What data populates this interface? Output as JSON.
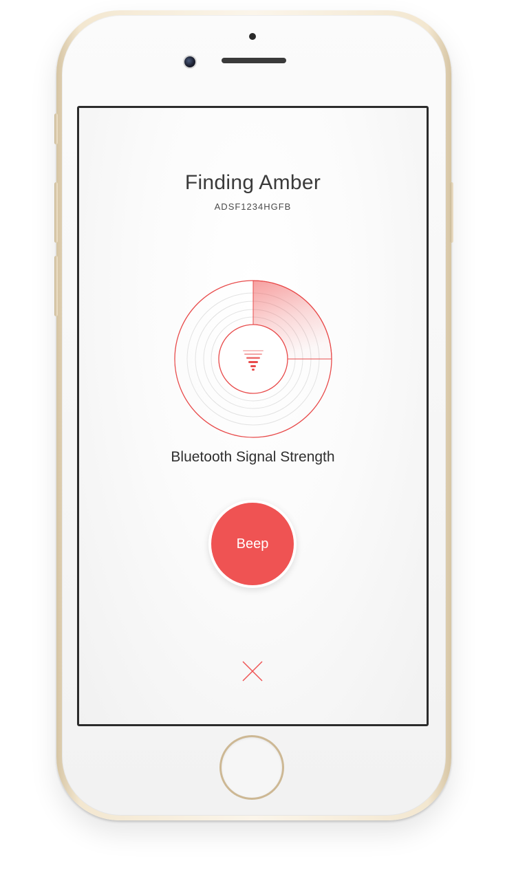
{
  "screen": {
    "title": "Finding Amber",
    "device_id": "ADSF1234HGFB",
    "signal_label": "Bluetooth Signal Strength",
    "signal_strength_fraction": 0.25,
    "beep_button_label": "Beep",
    "close_icon": "close-icon",
    "signal_icon": "signal-funnel-icon"
  },
  "colors": {
    "accent": "#ef5353",
    "ring_stroke": "#e84a4a",
    "grid_ring": "#e2e2e2",
    "text_primary": "#3a3a3a",
    "phone_gold": "#d6c5a4"
  }
}
